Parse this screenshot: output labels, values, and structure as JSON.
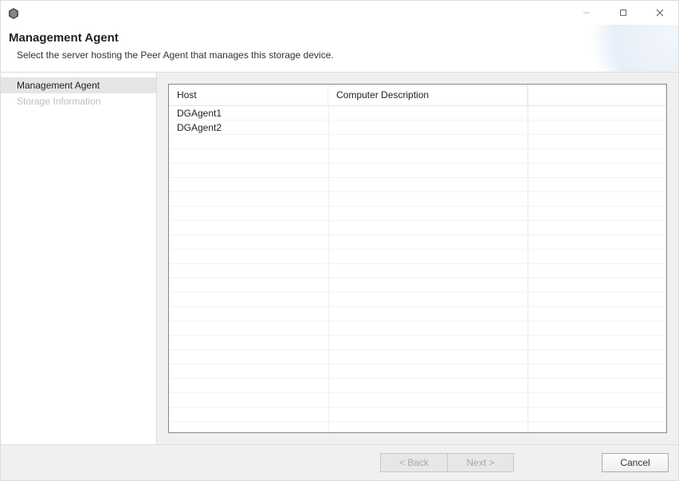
{
  "titlebar": {
    "app_icon": "hexagon-icon"
  },
  "header": {
    "title": "Management Agent",
    "subtitle": "Select the server hosting the Peer Agent that manages this storage device."
  },
  "sidebar": {
    "items": [
      {
        "label": "Management Agent",
        "active": true,
        "disabled": false
      },
      {
        "label": "Storage Information",
        "active": false,
        "disabled": true
      }
    ]
  },
  "table": {
    "columns": [
      {
        "label": "Host"
      },
      {
        "label": "Computer Description"
      }
    ],
    "rows": [
      {
        "host": "DGAgent1",
        "description": ""
      },
      {
        "host": "DGAgent2",
        "description": ""
      }
    ],
    "blank_rows": 20
  },
  "footer": {
    "back_label": "< Back",
    "next_label": "Next >",
    "cancel_label": "Cancel"
  }
}
